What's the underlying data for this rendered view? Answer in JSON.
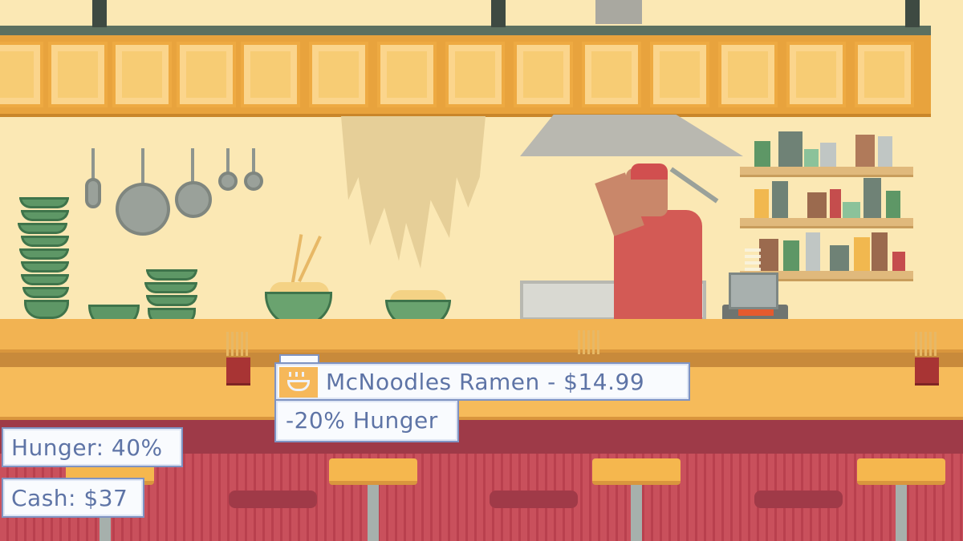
{
  "tooltip": {
    "item_title": "McNoodles Ramen - $14.99",
    "effect": "-20% Hunger",
    "icon": "ramen-bowl-icon"
  },
  "stats": {
    "hunger": "Hunger: 40%",
    "cash": "Cash: $37"
  },
  "colors": {
    "ui_text": "#5e74a6",
    "ui_border": "#7f93c2",
    "ui_background": "#f9fbfe",
    "wall": "#fbe8b4",
    "counter": "#f2b352",
    "counter_base": "#9e3a48"
  }
}
